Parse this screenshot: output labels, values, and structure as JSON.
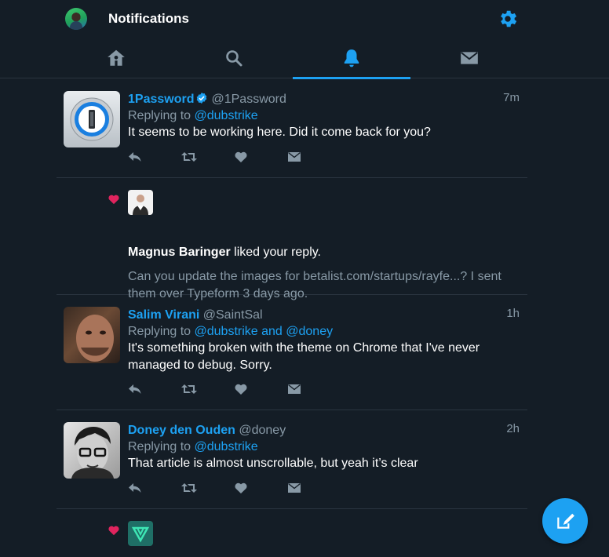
{
  "header": {
    "title": "Notifications",
    "avatar_icon": "user-avatar",
    "settings_icon": "gear-icon"
  },
  "tabs": [
    {
      "name": "home",
      "icon": "home-icon",
      "active": false
    },
    {
      "name": "search",
      "icon": "search-icon",
      "active": false
    },
    {
      "name": "notifications",
      "icon": "bell-icon",
      "active": true
    },
    {
      "name": "messages",
      "icon": "envelope-icon",
      "active": false
    }
  ],
  "colors": {
    "accent": "#1da1f2",
    "background": "#141d26",
    "muted": "#8899a6",
    "divider": "#2a3540",
    "like": "#e0245e"
  },
  "feed": {
    "tweet1": {
      "name": "1Password",
      "handle": "@1Password",
      "time": "7m",
      "reply_prefix": "Replying to",
      "reply_to": "@dubstrike",
      "text": "It seems to be working here. Did it come back for you?"
    },
    "like1": {
      "liker": "Magnus Baringer",
      "action": "liked your reply.",
      "quote": "Can you update the images for betalist.com/startups/rayfe...? I sent them over Typeform 3 days ago."
    },
    "tweet2": {
      "name": "Salim Virani",
      "handle": "@SaintSal",
      "time": "1h",
      "reply_prefix": "Replying to",
      "reply_to": "@dubstrike and @doney",
      "text": "It's something broken with the theme on Chrome that I've never managed to debug. Sorry."
    },
    "tweet3": {
      "name": "Doney den Ouden",
      "handle": "@doney",
      "time": "2h",
      "reply_prefix": "Replying to",
      "reply_to": "@dubstrike",
      "text": "That article is almost unscrollable, but yeah it’s clear"
    }
  },
  "fab": {
    "icon": "compose-icon"
  }
}
